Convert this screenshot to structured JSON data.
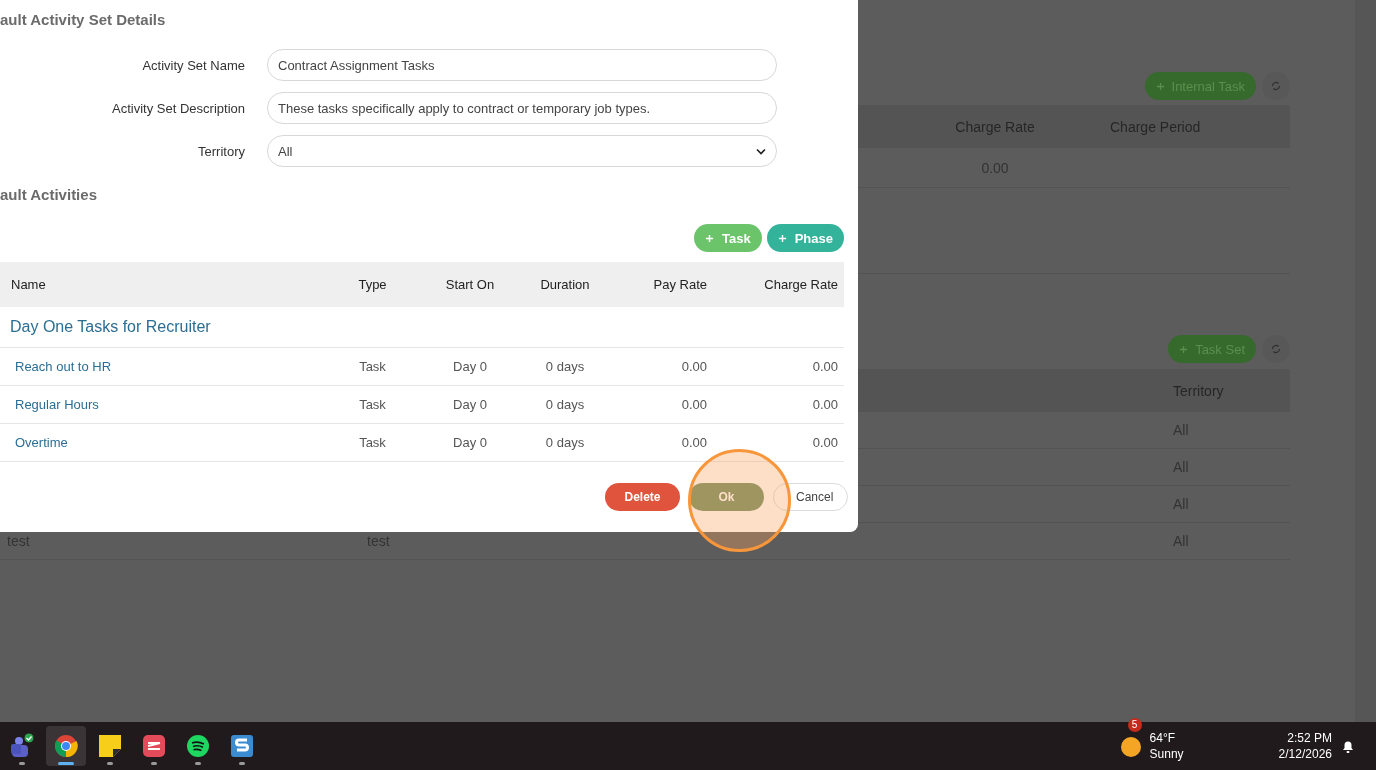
{
  "background": {
    "internal_tasks": {
      "add_button": "Internal Task",
      "columns": [
        "Charge Rate",
        "Charge Period"
      ],
      "rows": [
        {
          "charge_rate": "0.00"
        }
      ]
    },
    "task_sets": {
      "add_button": "Task Set",
      "columns": [
        "Territory"
      ],
      "rows": [
        {
          "territory": "All"
        },
        {
          "territory": "All"
        },
        {
          "territory": "All"
        },
        {
          "name": "test",
          "column_2": "test",
          "territory": "All"
        }
      ]
    }
  },
  "dialog": {
    "details_title": "ault Activity Set Details",
    "fields": [
      {
        "kind": "text",
        "label": "Activity Set Name",
        "value": "Contract Assignment Tasks"
      },
      {
        "kind": "text",
        "label": "Activity Set Description",
        "value": "These tasks specifically apply to contract or temporary job types."
      },
      {
        "kind": "select",
        "label": "Territory",
        "value": "All"
      }
    ],
    "activities_title": "ault Activities",
    "add_buttons": [
      {
        "kind": "task",
        "label": "Task"
      },
      {
        "kind": "phase",
        "label": "Phase"
      }
    ],
    "table": {
      "columns": [
        "Name",
        "Type",
        "Start On",
        "Duration",
        "Pay Rate",
        "Charge Rate"
      ],
      "group": "Day One Tasks for Recruiter",
      "rows": [
        {
          "name": "Reach out to HR",
          "type": "Task",
          "start_on": "Day 0",
          "duration": "0 days",
          "pay_rate": "0.00",
          "charge_rate": "0.00"
        },
        {
          "name": "Regular Hours",
          "type": "Task",
          "start_on": "Day 0",
          "duration": "0 days",
          "pay_rate": "0.00",
          "charge_rate": "0.00"
        },
        {
          "name": "Overtime",
          "type": "Task",
          "start_on": "Day 0",
          "duration": "0 days",
          "pay_rate": "0.00",
          "charge_rate": "0.00"
        }
      ]
    },
    "buttons": [
      {
        "kind": "delete",
        "label": "Delete"
      },
      {
        "kind": "ok",
        "label": "Ok"
      },
      {
        "kind": "cancel",
        "label": "Cancel"
      }
    ]
  },
  "taskbar": {
    "apps": [
      {
        "kind": "teams",
        "selected": false
      },
      {
        "kind": "chrome",
        "selected": true
      },
      {
        "kind": "notes",
        "selected": false
      },
      {
        "kind": "todo",
        "selected": false
      },
      {
        "kind": "spotify",
        "selected": false
      },
      {
        "kind": "snagit",
        "selected": false
      }
    ],
    "weather": {
      "badge": "5",
      "temperature": "64°F",
      "condition": "Sunny"
    },
    "time": "2:52 PM",
    "date": "2/12/2026"
  }
}
